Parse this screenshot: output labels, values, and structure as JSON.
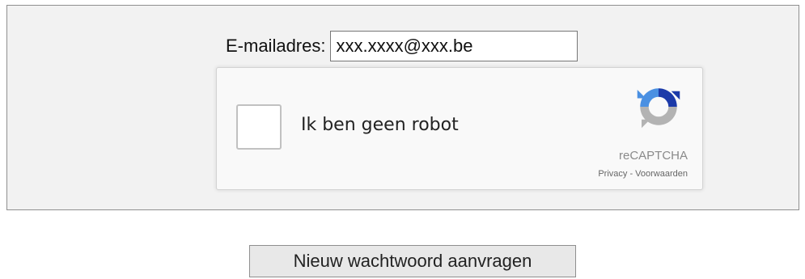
{
  "form": {
    "email_label": "E-mailadres:",
    "email_value": "xxx.xxxx@xxx.be"
  },
  "recaptcha": {
    "checkbox_label": "Ik ben geen robot",
    "brand": "reCAPTCHA",
    "privacy_link": "Privacy",
    "separator": " - ",
    "terms_link": "Voorwaarden",
    "logo_icon": "recaptcha-logo-icon",
    "colors": {
      "blue": "#1c3aa9",
      "light_blue": "#4a90e2",
      "gray": "#b3b3b3"
    }
  },
  "actions": {
    "submit_label": "Nieuw wachtwoord aanvragen"
  }
}
